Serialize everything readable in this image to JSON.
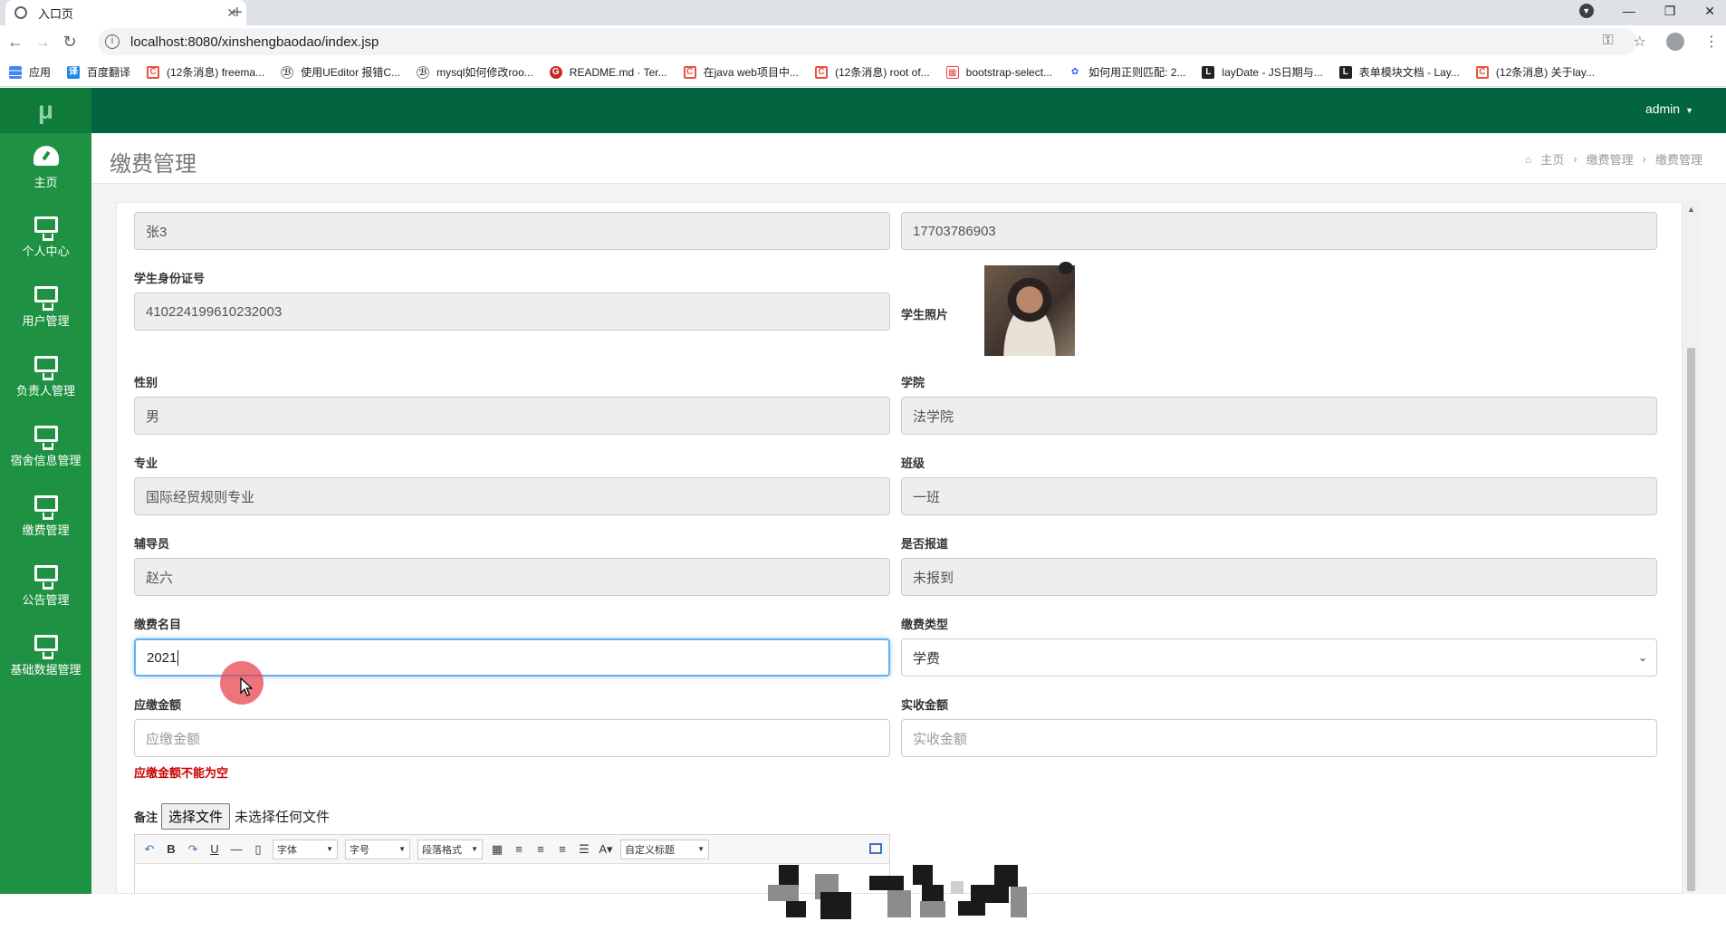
{
  "browser": {
    "tab_title": "入口页",
    "url": "localhost:8080/xinshengbaodao/index.jsp",
    "bookmarks": [
      {
        "label": "应用",
        "icon": "apps-grid-icon"
      },
      {
        "label": "百度翻译",
        "icon": "baidu-translate-icon"
      },
      {
        "label": "(12条消息) freema...",
        "icon": "csdn-icon"
      },
      {
        "label": "使用UEditor 报错C...",
        "icon": "ueditor-icon"
      },
      {
        "label": "mysql如何修改roo...",
        "icon": "ueditor-icon"
      },
      {
        "label": "README.md · Ter...",
        "icon": "gitee-icon"
      },
      {
        "label": "在java web项目中...",
        "icon": "csdn-icon"
      },
      {
        "label": "(12条消息) root of...",
        "icon": "csdn-icon"
      },
      {
        "label": "bootstrap-select...",
        "icon": "bootstrap-icon"
      },
      {
        "label": "如何用正则匹配: 2...",
        "icon": "baidu-paw-icon"
      },
      {
        "label": "layDate - JS日期与...",
        "icon": "layui-icon"
      },
      {
        "label": "表单模块文档 - Lay...",
        "icon": "layui-icon"
      },
      {
        "label": "(12条消息) 关于lay...",
        "icon": "csdn-icon"
      }
    ]
  },
  "sidebar": {
    "logo": "μ",
    "items": [
      {
        "label": "主页",
        "icon": "dashboard-icon"
      },
      {
        "label": "个人中心",
        "icon": "monitor-icon"
      },
      {
        "label": "用户管理",
        "icon": "monitor-icon"
      },
      {
        "label": "负责人管理",
        "icon": "monitor-icon"
      },
      {
        "label": "宿舍信息管理",
        "icon": "monitor-icon"
      },
      {
        "label": "缴费管理",
        "icon": "monitor-icon"
      },
      {
        "label": "公告管理",
        "icon": "monitor-icon"
      },
      {
        "label": "基础数据管理",
        "icon": "monitor-icon"
      }
    ]
  },
  "topbar": {
    "user": "admin"
  },
  "page": {
    "title": "缴费管理",
    "breadcrumb": [
      "主页",
      "缴费管理",
      "缴费管理"
    ]
  },
  "form": {
    "name_value": "张3",
    "phone_value": "17703786903",
    "id_card": {
      "label": "学生身份证号",
      "value": "410224199610232003"
    },
    "photo": {
      "label": "学生照片"
    },
    "gender": {
      "label": "性别",
      "value": "男"
    },
    "college": {
      "label": "学院",
      "value": "法学院"
    },
    "major": {
      "label": "专业",
      "value": "国际经贸规则专业"
    },
    "class": {
      "label": "班级",
      "value": "一班"
    },
    "counselor": {
      "label": "辅导员",
      "value": "赵六"
    },
    "reported": {
      "label": "是否报道",
      "value": "未报到"
    },
    "fee_name": {
      "label": "缴费名目",
      "value": "2021"
    },
    "fee_type": {
      "label": "缴费类型",
      "value": "学费"
    },
    "amount_due": {
      "label": "应缴金额",
      "placeholder": "应缴金额",
      "error": "应缴金额不能为空"
    },
    "amount_paid": {
      "label": "实收金额",
      "placeholder": "实收金额"
    },
    "remark": {
      "label": "备注",
      "file_button": "选择文件",
      "file_status": "未选择任何文件"
    },
    "editor": {
      "font": "字体",
      "size": "字号",
      "paragraph": "段落格式",
      "custom_title": "自定义标题"
    }
  },
  "colors": {
    "sidebar": "#1e9142",
    "topbar": "#036540",
    "error": "#cc0000",
    "focus": "#66afe9"
  }
}
